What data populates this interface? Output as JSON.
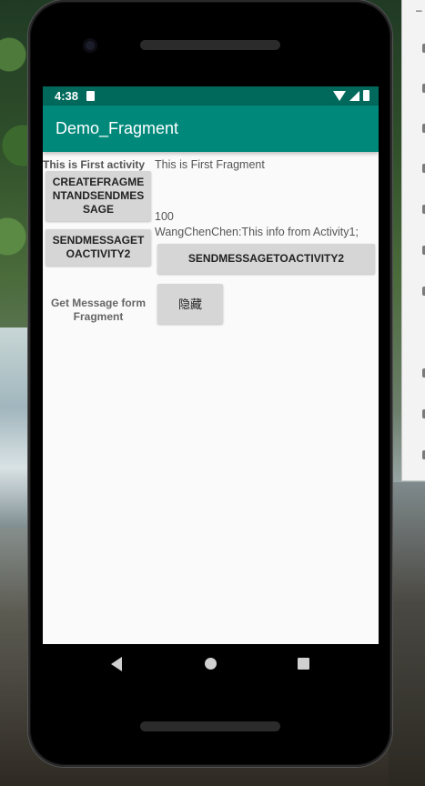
{
  "status_bar": {
    "time": "4:38",
    "icons": [
      "sd-card-icon",
      "wifi-icon",
      "signal-icon",
      "battery-icon"
    ]
  },
  "app_bar": {
    "title": "Demo_Fragment",
    "color": "#00897b",
    "status_color": "#00695c"
  },
  "activity": {
    "label": "This is First activity",
    "create_button": "CREATEFRAGMENTANDSENDMESSAGE",
    "send_button": "SENDMESSAGETOACTIVITY2",
    "message_label": "Get Message form Fragment"
  },
  "fragment": {
    "label": "This is First Fragment",
    "number": "100",
    "info": "WangChenChen:This info from Activity1;",
    "send_button": "SENDMESSAGETOACTIVITY2",
    "hide_button": "隐藏"
  },
  "nav_bar": {
    "icons": [
      "back-icon",
      "home-icon",
      "recents-icon"
    ]
  }
}
